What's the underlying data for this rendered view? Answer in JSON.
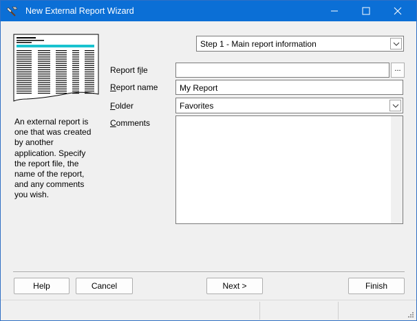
{
  "window": {
    "title": "New External Report Wizard"
  },
  "step": {
    "selected": "Step 1 - Main report information"
  },
  "description": "An external report is one that was created by another application. Specify the report file, the name of the report, and any comments you wish.",
  "form": {
    "report_file": {
      "label_pre": "Report f",
      "label_key": "i",
      "label_post": "le",
      "value": ""
    },
    "browse_label": "...",
    "report_name": {
      "label_pre": "",
      "label_key": "R",
      "label_post": "eport name",
      "value": "My Report"
    },
    "folder": {
      "label_pre": "",
      "label_key": "F",
      "label_post": "older",
      "value": "Favorites"
    },
    "comments": {
      "label_pre": "",
      "label_key": "C",
      "label_post": "omments",
      "value": ""
    }
  },
  "buttons": {
    "help": "Help",
    "cancel": "Cancel",
    "next": "Next >",
    "finish": "Finish"
  },
  "icons": {
    "app": "wrench-hammer-icon",
    "minimize": "minimize-icon",
    "maximize": "maximize-icon",
    "close": "close-icon",
    "dropdown": "chevron-down-icon",
    "preview": "report-preview-icon",
    "grip": "resize-grip-icon"
  },
  "colors": {
    "titlebar": "#0b6fd6",
    "preview_header": "#19c3cf"
  }
}
